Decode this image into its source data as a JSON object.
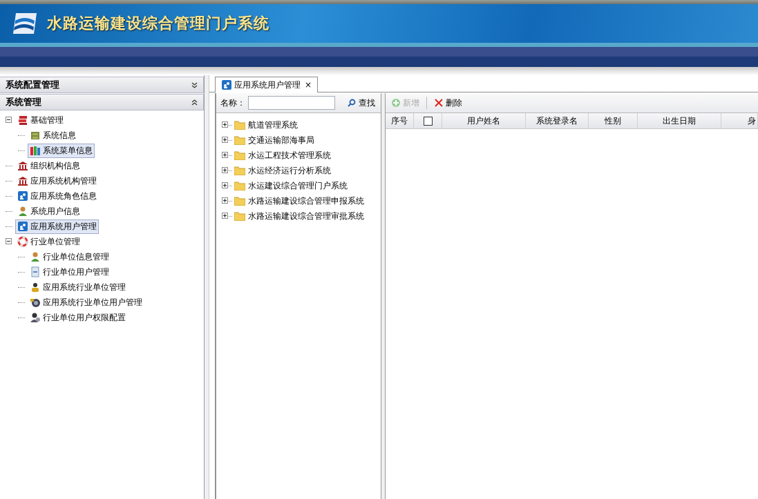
{
  "header": {
    "title": "水路运输建设综合管理门户系统"
  },
  "sidebar": {
    "panels": [
      {
        "title": "系统配置管理",
        "expanded": false
      },
      {
        "title": "系统管理",
        "expanded": true
      }
    ],
    "tree": [
      {
        "label": "基础管理",
        "kind": "stack",
        "expanded": true,
        "selected": false,
        "children": [
          {
            "label": "系统信息",
            "kind": "cabinet",
            "selected": false
          },
          {
            "label": "系统菜单信息",
            "kind": "binder",
            "selected": true
          }
        ]
      },
      {
        "label": "组织机构信息",
        "kind": "building",
        "selected": false
      },
      {
        "label": "应用系统机构管理",
        "kind": "building",
        "selected": false
      },
      {
        "label": "应用系统角色信息",
        "kind": "people",
        "selected": false
      },
      {
        "label": "系统用户信息",
        "kind": "user",
        "selected": false
      },
      {
        "label": "应用系统用户管理",
        "kind": "people",
        "selected": true
      },
      {
        "label": "行业单位管理",
        "kind": "ring",
        "expanded": true,
        "selected": false,
        "children": [
          {
            "label": "行业单位信息管理",
            "kind": "user",
            "selected": false
          },
          {
            "label": "行业单位用户管理",
            "kind": "document",
            "selected": false
          },
          {
            "label": "应用系统行业单位管理",
            "kind": "person",
            "selected": false
          },
          {
            "label": "应用系统行业单位用户管理",
            "kind": "camera",
            "selected": false
          },
          {
            "label": "行业单位用户权限配置",
            "kind": "usergear",
            "selected": false
          }
        ]
      }
    ]
  },
  "tabs": [
    {
      "label": "应用系统用户管理",
      "selected": true,
      "close": "×"
    }
  ],
  "org_panel": {
    "search_label": "名称：",
    "search_button": "查找",
    "tree": [
      {
        "label": "航道管理系统",
        "expanded": false
      },
      {
        "label": "交通运输部海事局",
        "expanded": false
      },
      {
        "label": "水运工程技术管理系统",
        "expanded": false
      },
      {
        "label": "水运经济运行分析系统",
        "expanded": false
      },
      {
        "label": "水运建设综合管理门户系统",
        "expanded": false
      },
      {
        "label": "水路运输建设综合管理申报系统",
        "expanded": false
      },
      {
        "label": "水路运输建设综合管理审批系统",
        "expanded": false
      }
    ]
  },
  "toolbar": [
    {
      "label": "新增",
      "kind": "add",
      "disabled": true
    },
    {
      "label": "删除",
      "kind": "delete",
      "disabled": false
    }
  ],
  "table": {
    "columns": [
      {
        "label": "序号",
        "kind": "text"
      },
      {
        "kind": "checkbox",
        "checked": false
      },
      {
        "label": "用户姓名",
        "kind": "text"
      },
      {
        "label": "系统登录名",
        "kind": "text"
      },
      {
        "label": "性别",
        "kind": "text"
      },
      {
        "label": "出生日期",
        "kind": "text"
      },
      {
        "label": "身",
        "kind": "text"
      }
    ]
  }
}
